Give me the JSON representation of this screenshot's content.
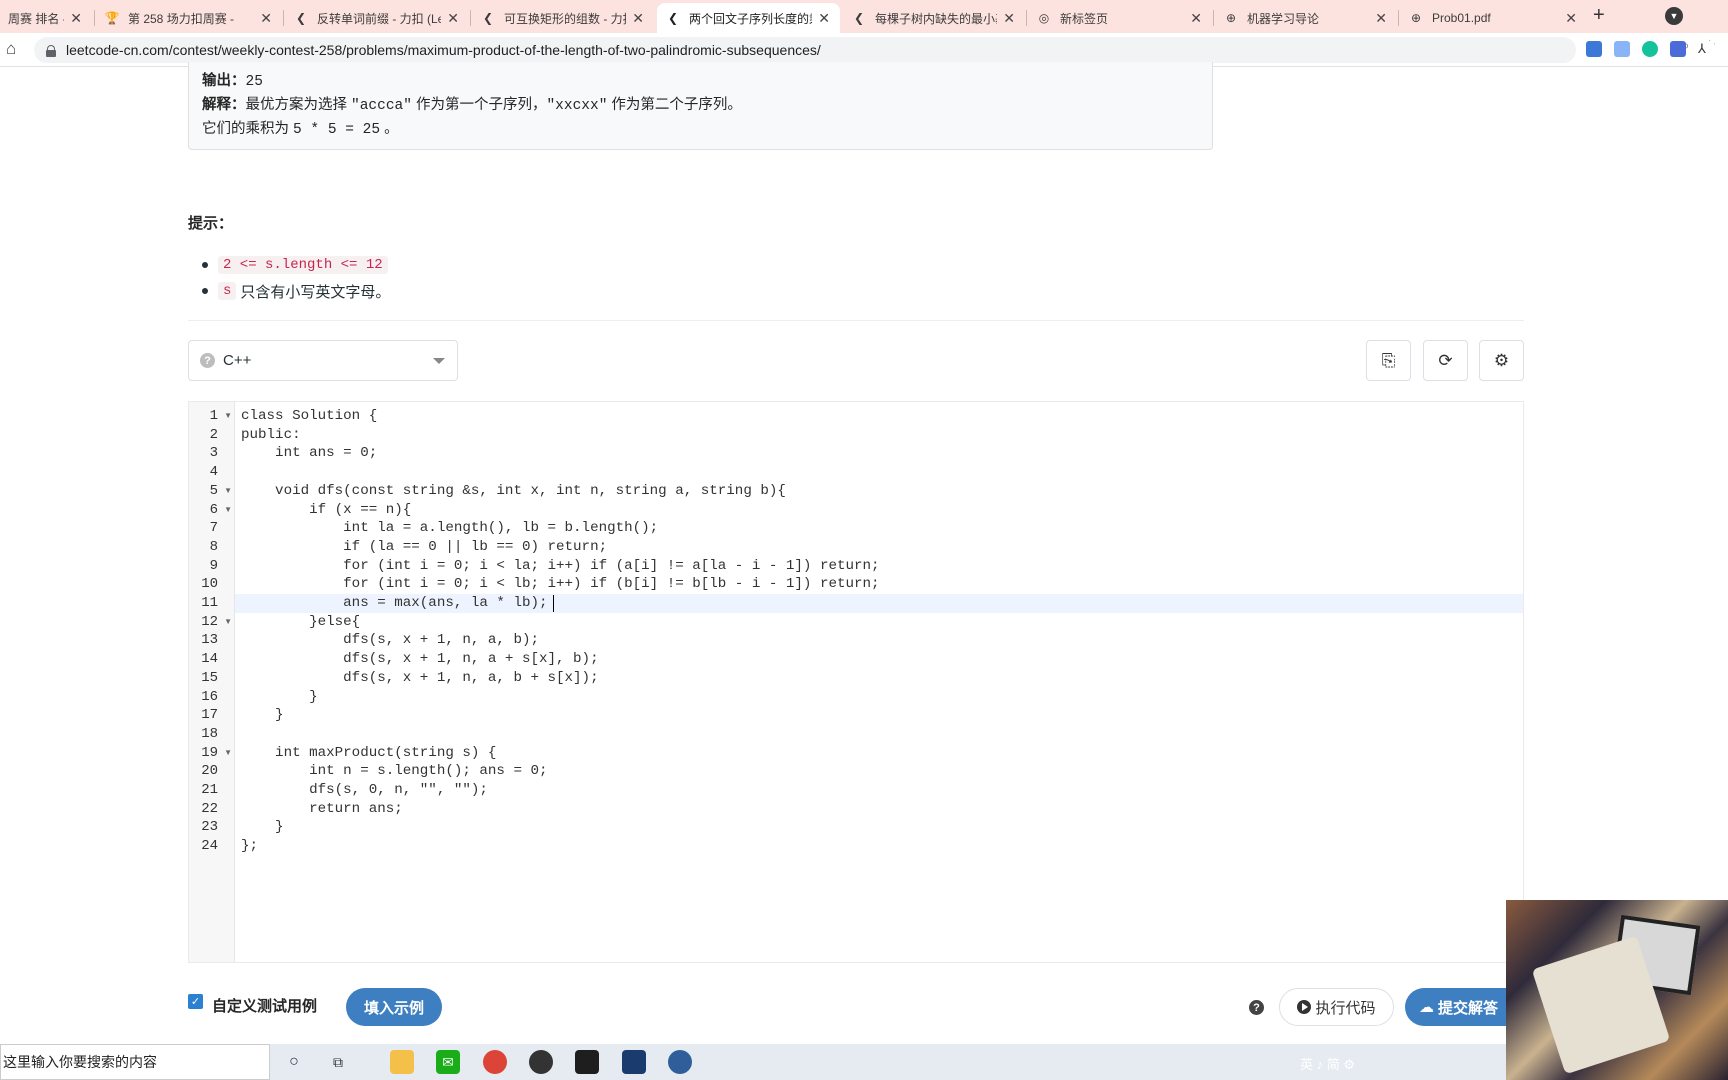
{
  "browser": {
    "tabs": [
      {
        "title": "周赛 排名 - 力扣",
        "icon": "leetcode-icon"
      },
      {
        "title": "第 258 场力扣周赛 -",
        "icon": "trophy-icon"
      },
      {
        "title": "反转单词前缀 - 力扣 (Lee",
        "icon": "leetcode-icon"
      },
      {
        "title": "可互换矩形的组数 - 力扣",
        "icon": "leetcode-icon"
      },
      {
        "title": "两个回文子序列长度的乘",
        "icon": "leetcode-icon",
        "active": true
      },
      {
        "title": "每棵子树内缺失的最小基",
        "icon": "leetcode-icon"
      },
      {
        "title": "新标签页",
        "icon": "chrome-icon"
      },
      {
        "title": "机器学习导论",
        "icon": "globe-icon"
      },
      {
        "title": "Prob01.pdf",
        "icon": "globe-icon"
      }
    ],
    "url": "leetcode-cn.com/contest/weekly-contest-258/problems/maximum-product-of-the-length-of-two-palindromic-subsequences/"
  },
  "example": {
    "output_label": "输出：",
    "output_value": "25",
    "explain_label": "解释：",
    "explain_pre": "最优方案为选择 ",
    "explain_a": "\"accca\"",
    "explain_mid": " 作为第一个子序列，",
    "explain_b": "\"xxcxx\"",
    "explain_post": " 作为第二个子序列。",
    "product_pre": "它们的乘积为 ",
    "product_expr": "5 * 5 = 25",
    "product_post": " 。"
  },
  "hints": {
    "title": "提示：",
    "items": [
      {
        "code": "2 <= s.length <= 12",
        "text": ""
      },
      {
        "code": "s",
        "text": "只含有小写英文字母。"
      }
    ]
  },
  "editor": {
    "language": "C++",
    "code_lines": [
      "class Solution {",
      "public:",
      "    int ans = 0;",
      "",
      "    void dfs(const string &s, int x, int n, string a, string b){",
      "        if (x == n){",
      "            int la = a.length(), lb = b.length();",
      "            if (la == 0 || lb == 0) return;",
      "            for (int i = 0; i < la; i++) if (a[i] != a[la - i - 1]) return;",
      "            for (int i = 0; i < lb; i++) if (b[i] != b[lb - i - 1]) return;",
      "            ans = max(ans, la * lb);",
      "        }else{",
      "            dfs(s, x + 1, n, a, b);",
      "            dfs(s, x + 1, n, a + s[x], b);",
      "            dfs(s, x + 1, n, a, b + s[x]);",
      "        }",
      "    }",
      "",
      "    int maxProduct(string s) {",
      "        int n = s.length(); ans = 0;",
      "        dfs(s, 0, n, \"\", \"\");",
      "        return ans;",
      "    }",
      "};"
    ],
    "fold_lines": [
      1,
      5,
      6,
      12,
      19
    ],
    "highlight_line": 11
  },
  "bottom": {
    "custom_testcase_label": "自定义测试用例",
    "fill_example_label": "填入示例",
    "run_label": "执行代码",
    "submit_label": "提交解答"
  },
  "taskbar": {
    "search_placeholder": "这里输入你要搜索的内容",
    "tray_text": "英 ♪ 简 ⚙"
  }
}
